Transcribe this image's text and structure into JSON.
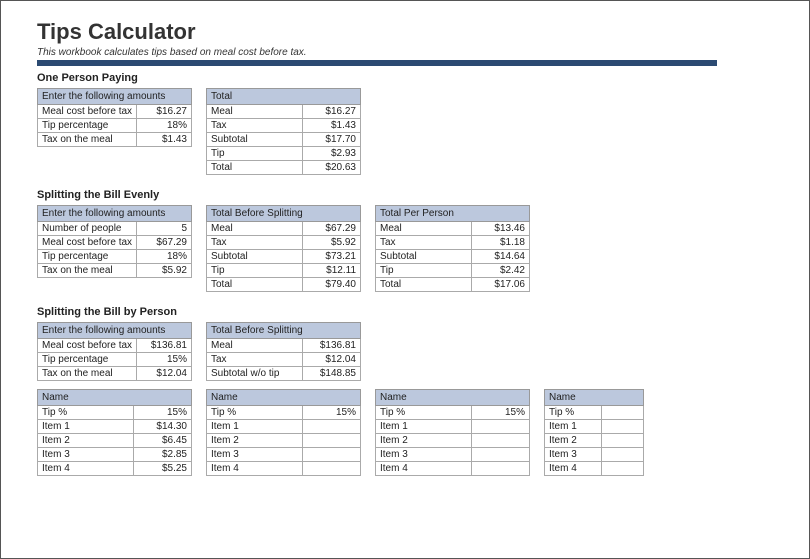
{
  "title": "Tips Calculator",
  "subtitle": "This workbook calculates tips based on meal cost before tax.",
  "sections": {
    "one": {
      "title": "One Person Paying",
      "inputs_header": "Enter the following amounts",
      "inputs": [
        {
          "label": "Meal cost before tax",
          "value": "$16.27"
        },
        {
          "label": "Tip percentage",
          "value": "18%"
        },
        {
          "label": "Tax on the meal",
          "value": "$1.43"
        }
      ],
      "total_header": "Total",
      "totals": [
        {
          "label": "Meal",
          "value": "$16.27"
        },
        {
          "label": "Tax",
          "value": "$1.43"
        },
        {
          "label": "Subtotal",
          "value": "$17.70"
        },
        {
          "label": "Tip",
          "value": "$2.93"
        },
        {
          "label": "Total",
          "value": "$20.63"
        }
      ]
    },
    "even": {
      "title": "Splitting the Bill Evenly",
      "inputs_header": "Enter the following amounts",
      "inputs": [
        {
          "label": "Number of people",
          "value": "5"
        },
        {
          "label": "Meal cost before tax",
          "value": "$67.29"
        },
        {
          "label": "Tip percentage",
          "value": "18%"
        },
        {
          "label": "Tax on the meal",
          "value": "$5.92"
        }
      ],
      "before_header": "Total Before Splitting",
      "before": [
        {
          "label": "Meal",
          "value": "$67.29"
        },
        {
          "label": "Tax",
          "value": "$5.92"
        },
        {
          "label": "Subtotal",
          "value": "$73.21"
        },
        {
          "label": "Tip",
          "value": "$12.11"
        },
        {
          "label": "Total",
          "value": "$79.40"
        }
      ],
      "per_header": "Total Per Person",
      "per": [
        {
          "label": "Meal",
          "value": "$13.46"
        },
        {
          "label": "Tax",
          "value": "$1.18"
        },
        {
          "label": "Subtotal",
          "value": "$14.64"
        },
        {
          "label": "Tip",
          "value": "$2.42"
        },
        {
          "label": "Total",
          "value": "$17.06"
        }
      ]
    },
    "byperson": {
      "title": "Splitting the Bill by Person",
      "inputs_header": "Enter the following amounts",
      "inputs": [
        {
          "label": "Meal cost before tax",
          "value": "$136.81"
        },
        {
          "label": "Tip percentage",
          "value": "15%"
        },
        {
          "label": "Tax on the meal",
          "value": "$12.04"
        }
      ],
      "before_header": "Total Before Splitting",
      "before": [
        {
          "label": "Meal",
          "value": "$136.81"
        },
        {
          "label": "Tax",
          "value": "$12.04"
        },
        {
          "label": "Subtotal w/o tip",
          "value": "$148.85"
        }
      ],
      "persons": [
        {
          "name_header": "Name",
          "rows": [
            {
              "label": "Tip %",
              "value": "15%"
            },
            {
              "label": "Item 1",
              "value": "$14.30"
            },
            {
              "label": "Item 2",
              "value": "$6.45"
            },
            {
              "label": "Item 3",
              "value": "$2.85"
            },
            {
              "label": "Item 4",
              "value": "$5.25"
            }
          ]
        },
        {
          "name_header": "Name",
          "rows": [
            {
              "label": "Tip %",
              "value": "15%"
            },
            {
              "label": "Item 1",
              "value": ""
            },
            {
              "label": "Item 2",
              "value": ""
            },
            {
              "label": "Item 3",
              "value": ""
            },
            {
              "label": "Item 4",
              "value": ""
            }
          ]
        },
        {
          "name_header": "Name",
          "rows": [
            {
              "label": "Tip %",
              "value": "15%"
            },
            {
              "label": "Item 1",
              "value": ""
            },
            {
              "label": "Item 2",
              "value": ""
            },
            {
              "label": "Item 3",
              "value": ""
            },
            {
              "label": "Item 4",
              "value": ""
            }
          ]
        },
        {
          "name_header": "Name",
          "rows": [
            {
              "label": "Tip %",
              "value": ""
            },
            {
              "label": "Item 1",
              "value": ""
            },
            {
              "label": "Item 2",
              "value": ""
            },
            {
              "label": "Item 3",
              "value": ""
            },
            {
              "label": "Item 4",
              "value": ""
            }
          ]
        }
      ]
    }
  }
}
